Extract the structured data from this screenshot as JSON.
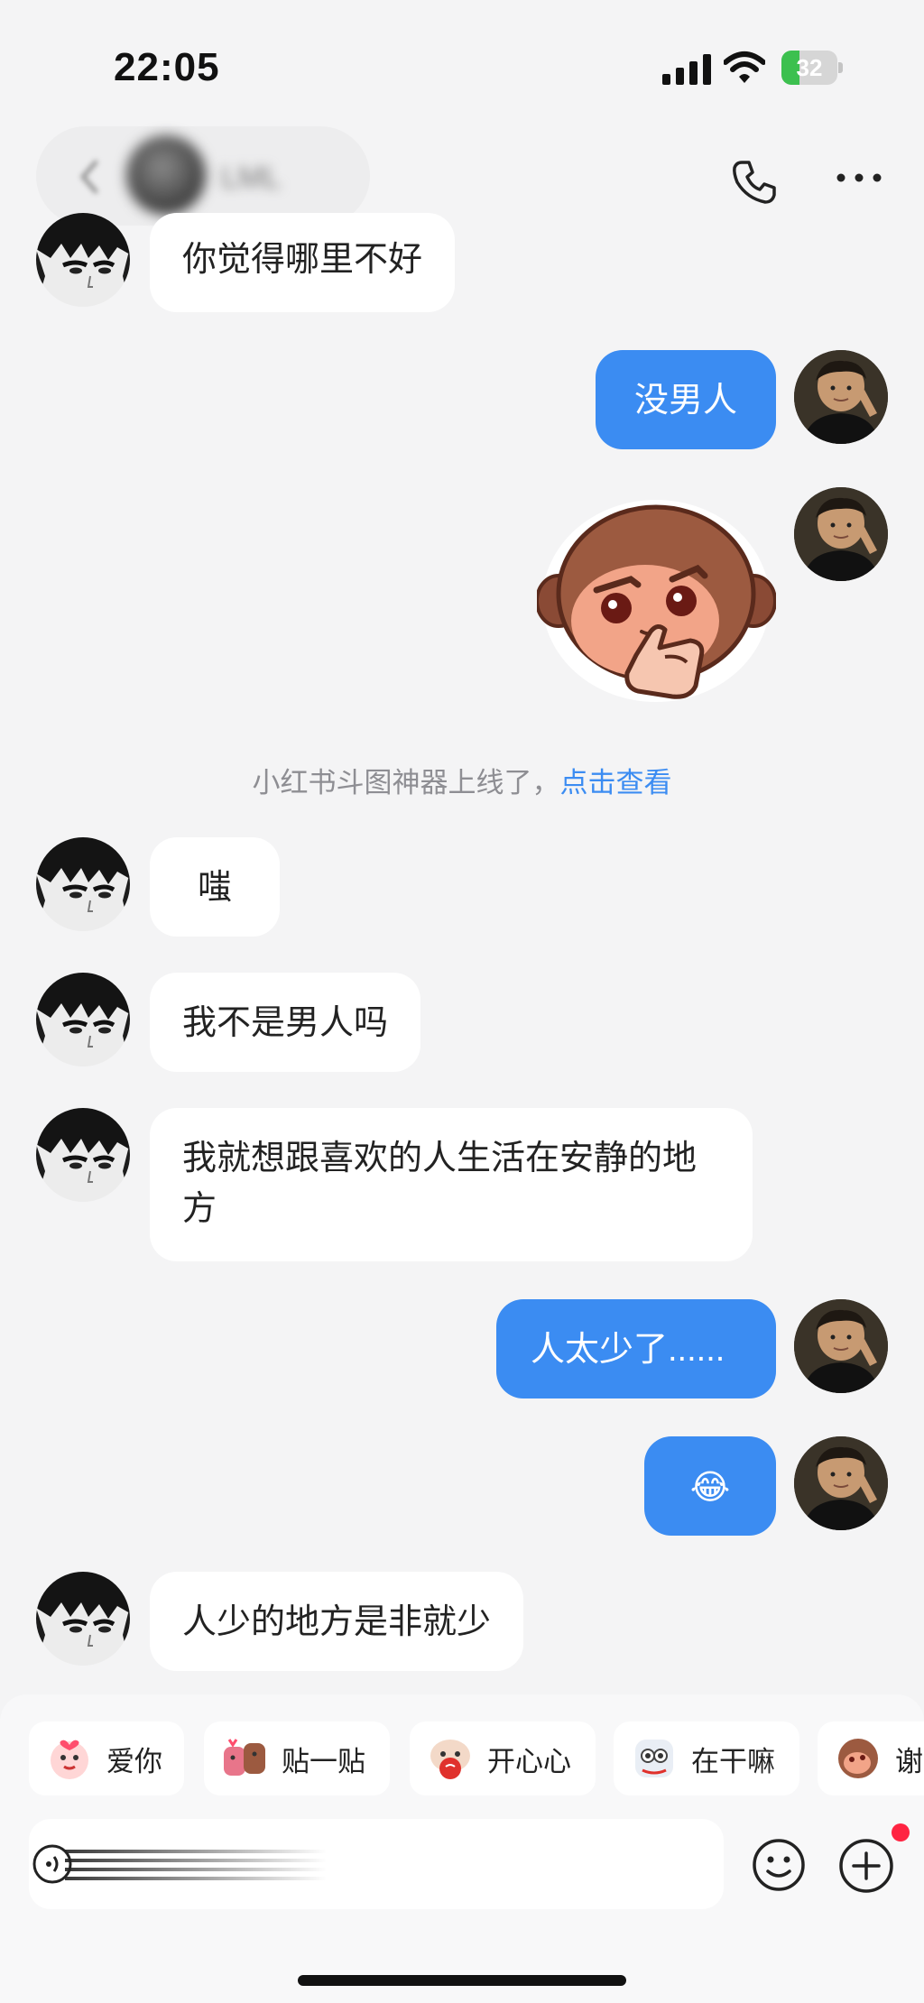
{
  "status_bar": {
    "time": "22:05",
    "battery": "32",
    "battery_level": 0.32
  },
  "header": {
    "contact_name": "LML"
  },
  "messages": [
    {
      "side": "left",
      "text": "你觉得哪里不好"
    },
    {
      "side": "right",
      "text": "没男人"
    },
    {
      "side": "right",
      "type": "sticker",
      "sticker": "smirking-monkey-sticker"
    },
    {
      "side": "left",
      "text": "嗤"
    },
    {
      "side": "left",
      "text": "我不是男人吗"
    },
    {
      "side": "left",
      "text": "我就想跟喜欢的人生活在安静的地方"
    },
    {
      "side": "right",
      "text": "人太少了......"
    },
    {
      "side": "right",
      "text": "😂"
    },
    {
      "side": "left",
      "text": "人少的地方是非就少"
    }
  ],
  "system_notice": {
    "text": "小红书斗图神器上线了，",
    "link": "点击查看"
  },
  "quick_stickers": [
    {
      "label": "爱你",
      "icon": "sticker-love-icon"
    },
    {
      "label": "贴一贴",
      "icon": "sticker-hug-icon"
    },
    {
      "label": "开心心",
      "icon": "sticker-happy-icon"
    },
    {
      "label": "在干嘛",
      "icon": "sticker-what-icon"
    },
    {
      "label": "谢",
      "icon": "sticker-thanks-icon"
    }
  ],
  "colors": {
    "accent": "#3b8cf2",
    "background": "#f4f4f5",
    "bubble_left": "#ffffff",
    "notification_dot": "#ff2442"
  }
}
